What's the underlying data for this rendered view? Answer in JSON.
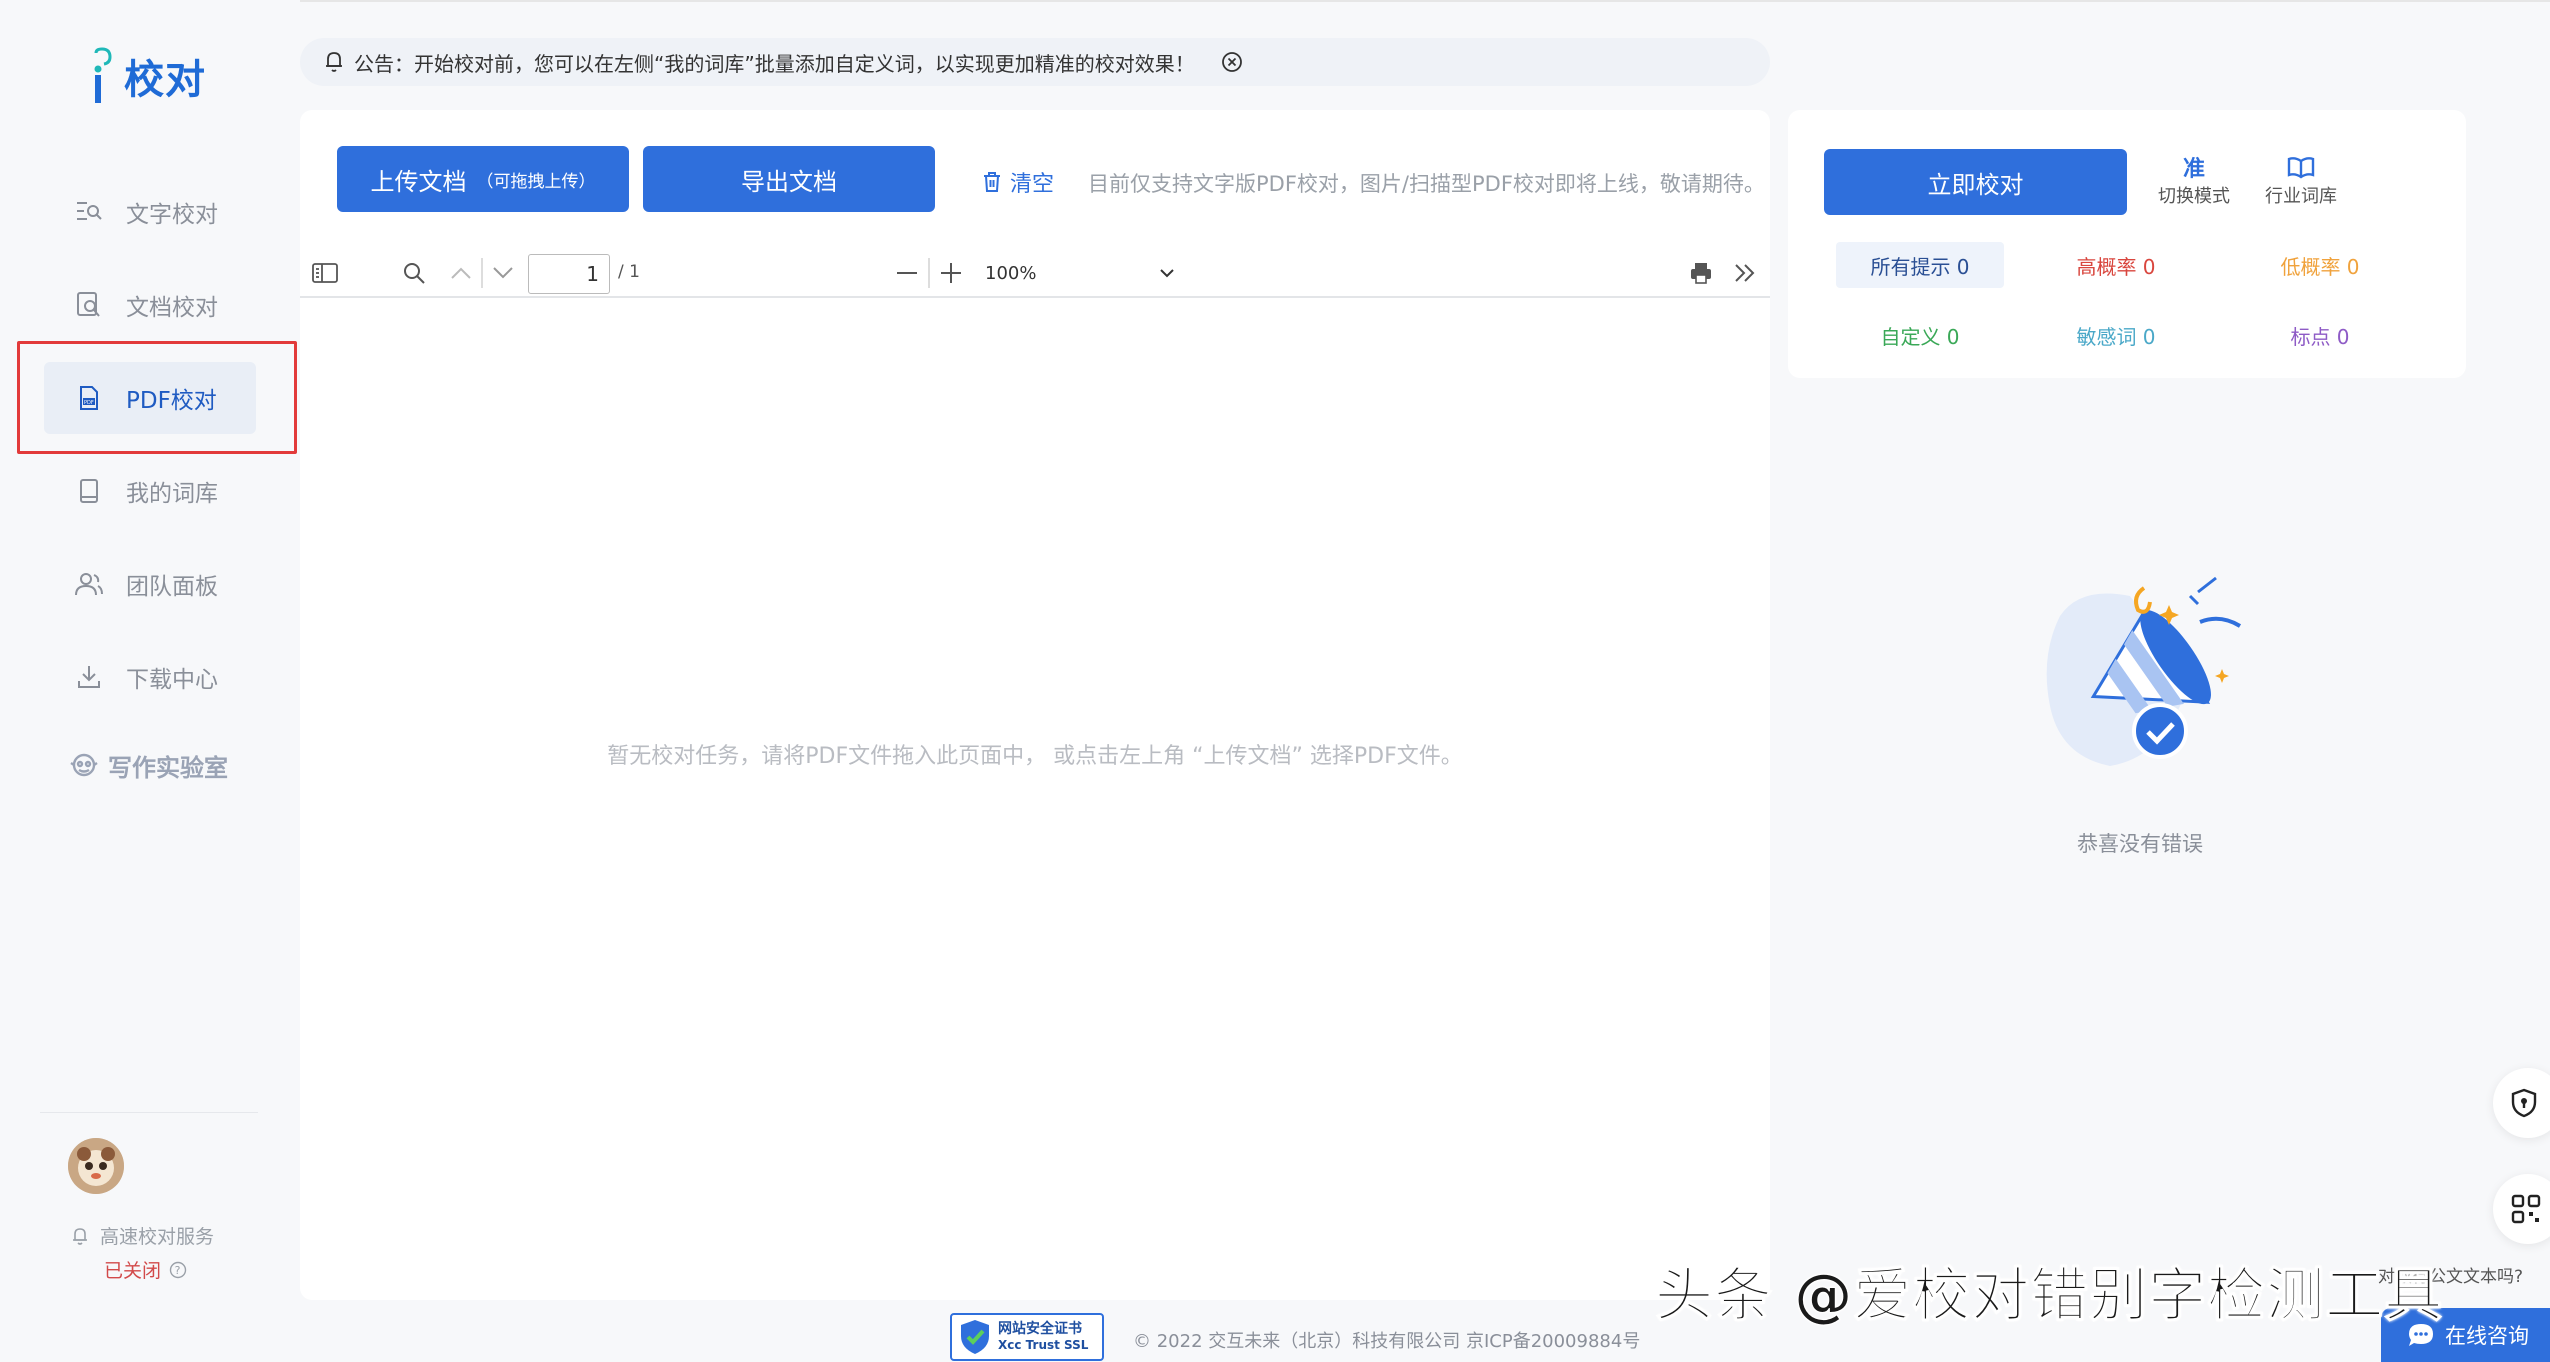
{
  "brand": {
    "logo_text": "校对"
  },
  "sidebar": {
    "items": [
      {
        "label": "文字校对",
        "icon": "text-proof-icon"
      },
      {
        "label": "文档校对",
        "icon": "doc-search-icon"
      },
      {
        "label": "PDF校对",
        "icon": "pdf-file-icon"
      },
      {
        "label": "我的词库",
        "icon": "book-icon"
      },
      {
        "label": "团队面板",
        "icon": "team-icon"
      },
      {
        "label": "下载中心",
        "icon": "download-icon"
      }
    ],
    "active_index": 2,
    "lab_label": "写作实验室",
    "service_label": "高速校对服务",
    "service_status": "已关闭"
  },
  "notice": {
    "text": "公告：开始校对前，您可以在左侧“我的词库”批量添加自定义词，以实现更加精准的校对效果！"
  },
  "toolbar": {
    "upload_label": "上传文档",
    "upload_hint": "（可拖拽上传）",
    "export_label": "导出文档",
    "clear_label": "清空",
    "support_note": "目前仅支持文字版PDF校对，图片/扫描型PDF校对即将上线，敬请期待。"
  },
  "pdf_viewer": {
    "page_value": "1",
    "page_total": "/ 1",
    "zoom": "100%",
    "empty_message": "暂无校对任务，请将PDF文件拖入此页面中， 或点击左上角 “上传文档” 选择PDF文件。"
  },
  "right_panel": {
    "proof_label": "立即校对",
    "mode_icon_text": "准",
    "mode_label": "切换模式",
    "lexicon_label": "行业词库",
    "stats": [
      {
        "label": "所有提示 0",
        "color": "#2a4f94"
      },
      {
        "label": "高概率 0",
        "color": "#d9463e"
      },
      {
        "label": "低概率 0",
        "color": "#f0a23c"
      },
      {
        "label": "自定义 0",
        "color": "#3aa857"
      },
      {
        "label": "敏感词 0",
        "color": "#4aa8c8"
      },
      {
        "label": "标点 0",
        "color": "#8e5bc6"
      }
    ],
    "result_text": "恭喜没有错误"
  },
  "floating": {
    "question": "对取行公文文本吗?",
    "consult_label": "在线咨询"
  },
  "footer": {
    "ssl_title": "网站安全证书",
    "ssl_sub": "Xcc Trust SSL",
    "copyright": "© 2022 交互未来（北京）科技有限公司 京ICP备20009884号"
  },
  "watermark": "头条 @爱校对错别字检测工具",
  "colors": {
    "accent": "#2f6fdc",
    "highlight_border": "#e23a3a"
  }
}
